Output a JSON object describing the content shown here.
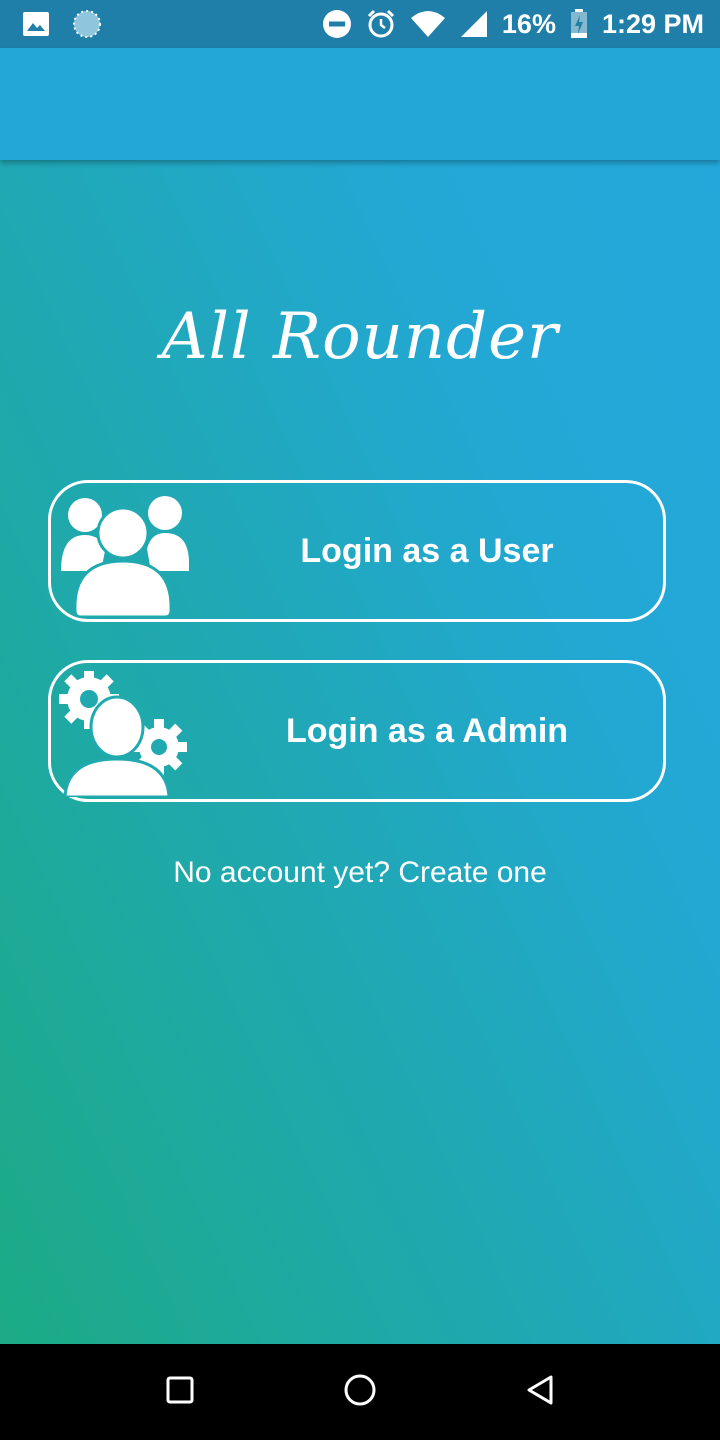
{
  "status_bar": {
    "battery": "16%",
    "time": "1:29 PM",
    "icons": [
      "image-icon",
      "loading-icon",
      "do-not-disturb-icon",
      "alarm-icon",
      "wifi-icon",
      "signal-icon",
      "battery-charging-icon"
    ]
  },
  "app": {
    "title": "All Rounder"
  },
  "login": {
    "user_label": "Login as a User",
    "admin_label": "Login as a Admin",
    "user_icon": "users-group-icon",
    "admin_icon": "admin-gears-icon"
  },
  "signup": {
    "link_text": "No account yet? Create one"
  },
  "nav": {
    "icons": [
      "recents-icon",
      "home-icon",
      "back-icon"
    ]
  },
  "colors": {
    "status_bar": "#1f7fa8",
    "app_bar": "#23a7d7",
    "gradient_start": "#1cab85",
    "gradient_end": "#24a8db",
    "text": "#ffffff"
  }
}
